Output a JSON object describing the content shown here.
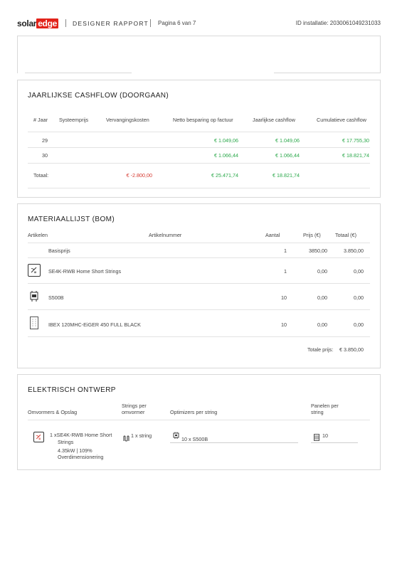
{
  "header": {
    "logo_text_a": "solar",
    "logo_text_b": "edge",
    "report_title": "DESIGNER RAPPORT",
    "page_indicator": "Pagina 6 van 7",
    "installation_id": "ID installatie: 2030061049231033"
  },
  "cashflow": {
    "title": "JAARLIJKSE CASHFLOW (DOORGAAN)",
    "columns": [
      "# Jaar",
      "Systeemprijs",
      "Vervangingskosten",
      "Netto besparing op factuur",
      "Jaarlijkse cashflow",
      "Cumulatieve cashflow"
    ],
    "rows": [
      {
        "year": "29",
        "system_price": "",
        "replacement": "",
        "net_savings": "€ 1.049,06",
        "annual": "€ 1.049,06",
        "cumulative": "€ 17.755,30"
      },
      {
        "year": "30",
        "system_price": "",
        "replacement": "",
        "net_savings": "€ 1.066,44",
        "annual": "€ 1.066,44",
        "cumulative": "€ 18.821,74"
      }
    ],
    "total": {
      "label": "Totaal:",
      "system_price": "",
      "replacement": "€ -2.800,00",
      "net_savings": "€ 25.471,74",
      "annual": "€ 18.821,74",
      "cumulative": ""
    },
    "colors": {
      "positive": "#2aa84a",
      "negative": "#d6382f"
    }
  },
  "bom": {
    "title": "MATERIAALLIJST (BOM)",
    "columns": [
      "Artikelen",
      "Artikelnummer",
      "Aantal",
      "Prijs (€)",
      "Totaal (€)"
    ],
    "rows": [
      {
        "icon": "none",
        "name": "Basisprijs",
        "part": "",
        "qty": "1",
        "price": "3850,00",
        "total": "3.850,00"
      },
      {
        "icon": "inverter-icon",
        "name": "SE4K-RWB Home Short Strings",
        "part": "",
        "qty": "1",
        "price": "0,00",
        "total": "0,00"
      },
      {
        "icon": "optimizer-icon",
        "name": "S500B",
        "part": "",
        "qty": "10",
        "price": "0,00",
        "total": "0,00"
      },
      {
        "icon": "solar-panel-icon",
        "name": "IBEX 120MHC-EiGER 450 FULL BLACK",
        "part": "",
        "qty": "10",
        "price": "0,00",
        "total": "0,00"
      }
    ],
    "total_label": "Totale prijs:",
    "total_value": "€ 3.850,00"
  },
  "electrical": {
    "title": "ELEKTRISCH ONTWERP",
    "col1": "Omvormers & Opslag",
    "col2_a": "Strings per",
    "col2_b": "omvormer",
    "col3": "Optimizers per string",
    "col4_a": "Panelen per",
    "col4_b": "string",
    "inverter_line1": "1 xSE4K-RWB Home Short",
    "inverter_line2": "Strings",
    "inverter_line3": "4.35kW | 109%",
    "inverter_line4": "Overdimensionering",
    "strings": "1 x string",
    "optimizers": "10 x S500B",
    "panels": "10"
  }
}
